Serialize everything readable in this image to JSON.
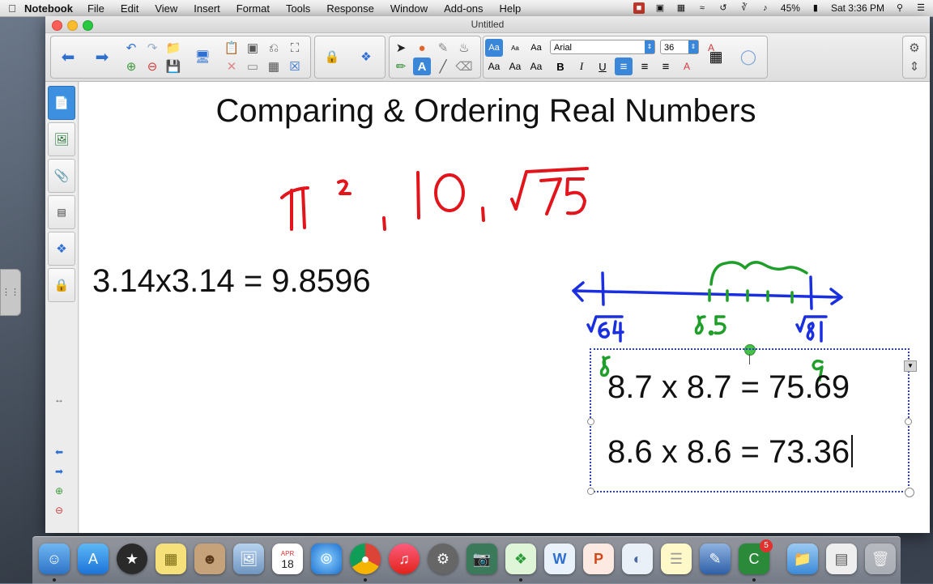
{
  "menubar": {
    "app_name": "Notebook",
    "menus": [
      "File",
      "Edit",
      "View",
      "Insert",
      "Format",
      "Tools",
      "Response",
      "Window",
      "Add-ons",
      "Help"
    ],
    "battery": "45%",
    "clock": "Sat 3:36 PM"
  },
  "window": {
    "title": "Untitled"
  },
  "toolbar": {
    "font_name": "Arial",
    "font_size": "36",
    "text_style_samples": [
      "Aa",
      "Aa",
      "Aa",
      "Aa",
      "Aa",
      "Aa"
    ],
    "bold": "B",
    "italic": "I",
    "underline": "U"
  },
  "canvas": {
    "title": "Comparing & Ordering Real Numbers",
    "pi_squared_equation": "3.14x3.14 = 9.8596",
    "box_line_1": "8.7 x 8.7 = 75.69",
    "box_line_2": "8.6 x 8.6 = 73.36"
  },
  "dock": {
    "calendar_month": "APR",
    "calendar_day": "18",
    "badge_count": "5"
  },
  "colors": {
    "ink_red": "#e2141c",
    "ink_blue": "#1a2fe0",
    "ink_green": "#1f9e2a",
    "selection_blue": "#3a86d8"
  }
}
